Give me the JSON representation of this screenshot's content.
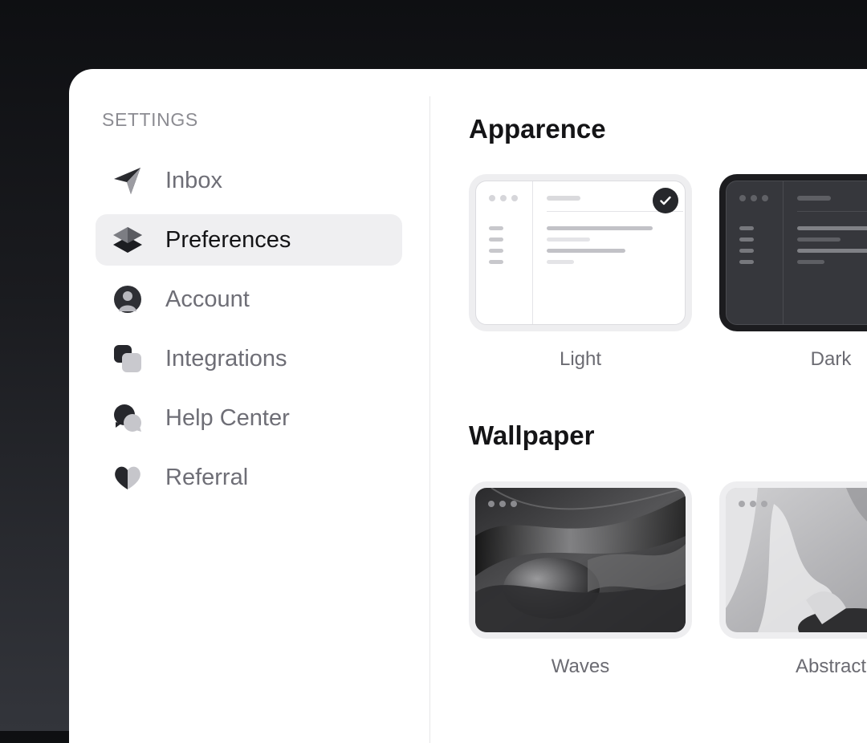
{
  "sidebar": {
    "title": "SETTINGS",
    "items": [
      {
        "label": "Inbox",
        "icon": "paper-plane-icon",
        "active": false
      },
      {
        "label": "Preferences",
        "icon": "layers-icon",
        "active": true
      },
      {
        "label": "Account",
        "icon": "user-icon",
        "active": false
      },
      {
        "label": "Integrations",
        "icon": "integrations-icon",
        "active": false
      },
      {
        "label": "Help Center",
        "icon": "chat-bubbles-icon",
        "active": false
      },
      {
        "label": "Referral",
        "icon": "heart-icon",
        "active": false
      }
    ]
  },
  "appearance": {
    "title": "Apparence",
    "options": [
      {
        "label": "Light",
        "selected": true
      },
      {
        "label": "Dark",
        "selected": false
      }
    ]
  },
  "wallpaper": {
    "title": "Wallpaper",
    "options": [
      {
        "label": "Waves"
      },
      {
        "label": "Abstract"
      }
    ]
  },
  "colors": {
    "active_bg": "#efeff1",
    "text_primary": "#141416",
    "text_muted": "#6e6e76",
    "check_badge": "#26272b"
  }
}
